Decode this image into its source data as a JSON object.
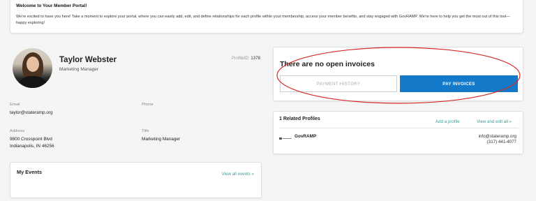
{
  "welcome": {
    "title": "Welcome to Your Member Portal!",
    "body": "We're excited to have you here! Take a moment to explore your portal, where you can easily add, edit, and define relationships for each profile within your membership, access your member benefits, and stay engaged with GovRAMP. We're here to help you get the most out of this tool—happy exploring!"
  },
  "profile": {
    "name": "Taylor Webster",
    "role": "Marketing Manager",
    "profile_id_label": "ProfileID:",
    "profile_id_value": "1378",
    "email_label": "Email",
    "email_value": "taylor@stateramp.org",
    "phone_label": "Phone",
    "phone_value": "",
    "address_label": "Address",
    "address_line1": "9800 Crosspoint Blvd",
    "address_line2": "Indianapolis, IN 46256",
    "title_label": "Title",
    "title_value": "Marketing Manager"
  },
  "events": {
    "title": "My Events",
    "view_all": "View all events »"
  },
  "invoices": {
    "title": "There are no open invoices",
    "history_button": "PAYMENT HISTORY",
    "pay_button": "PAY INVOICES"
  },
  "related": {
    "title": "1 Related Profiles",
    "add_profile": "Add a profile",
    "view_edit": "View and edit all »",
    "org": {
      "name": "GovRAMP",
      "email": "info@stateramp.org",
      "phone": "(317) 441-4077"
    }
  },
  "colors": {
    "accent_teal": "#3f9b8f",
    "primary_blue": "#1479c8",
    "annotation_red": "#d42a2a"
  }
}
